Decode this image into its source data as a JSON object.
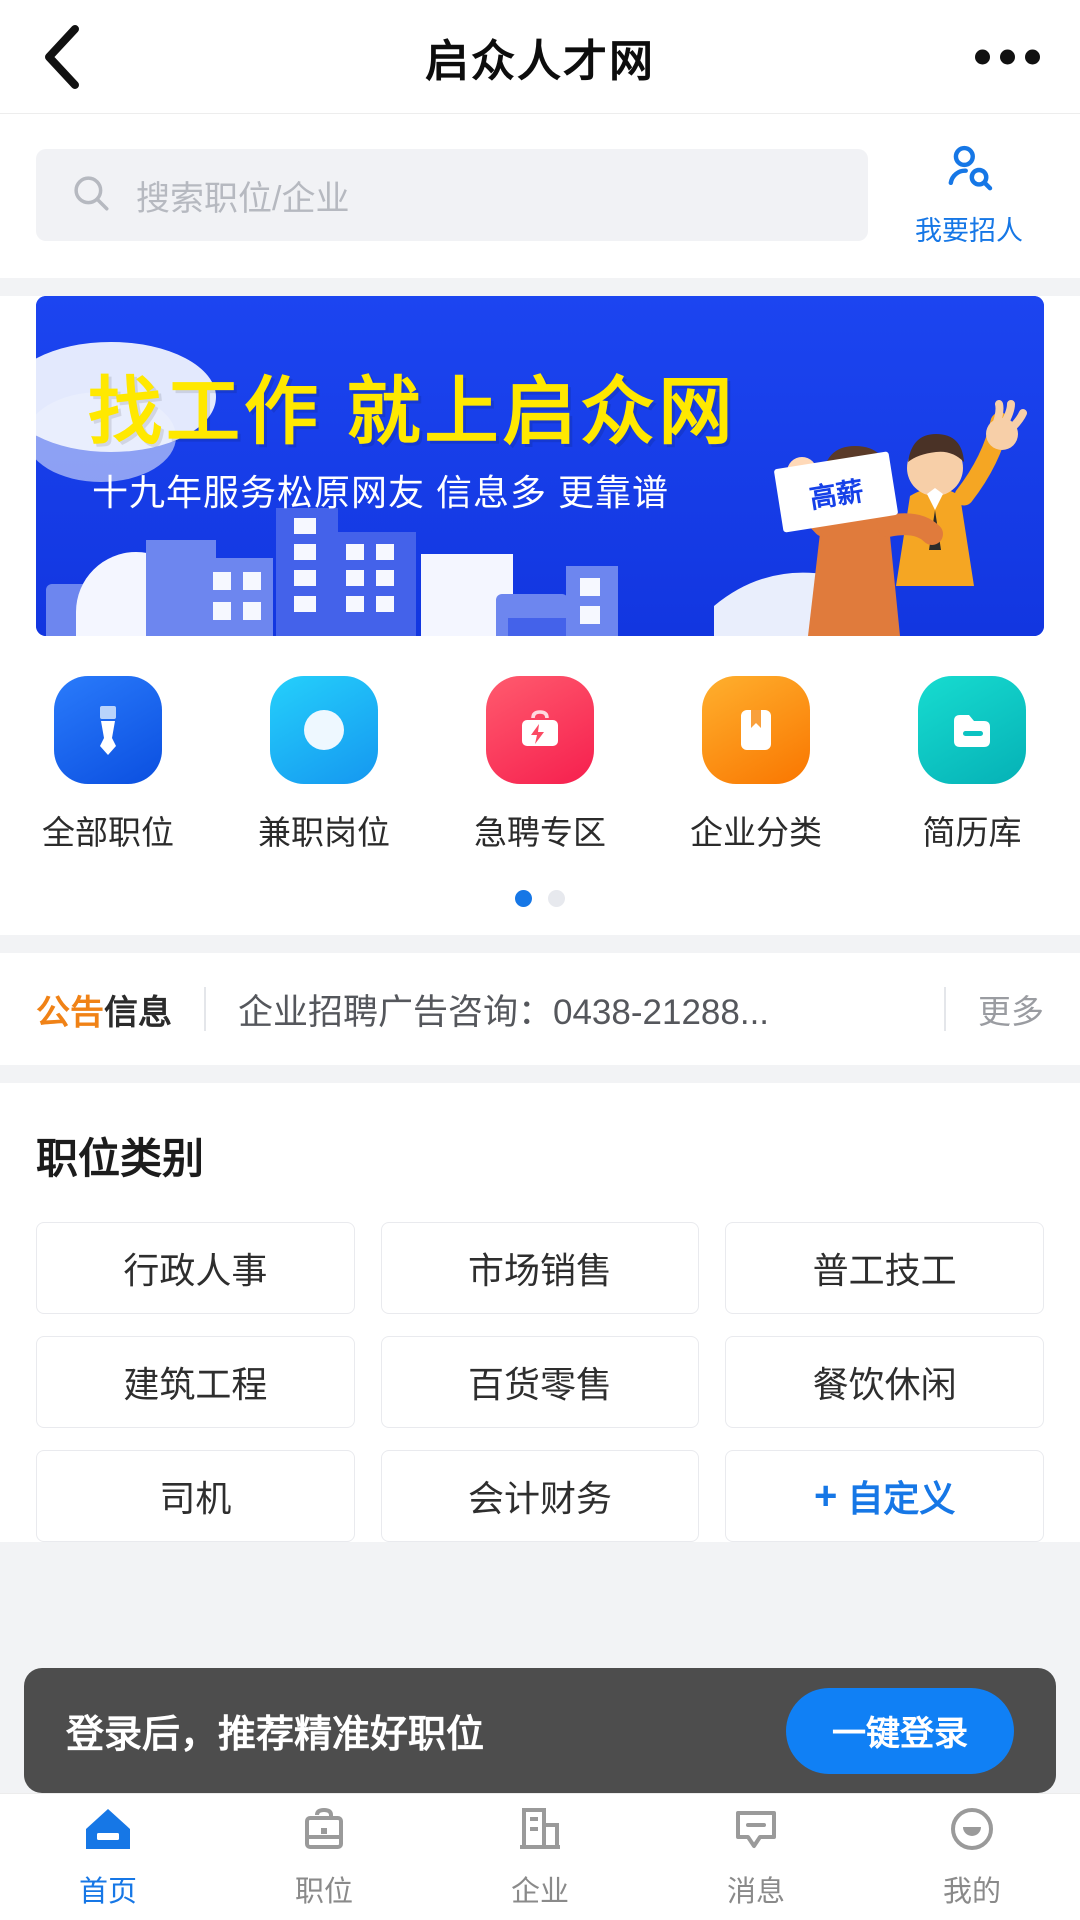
{
  "header": {
    "title": "启众人才网",
    "back_icon": "chevron-left-icon",
    "more_icon": "more-horizontal-icon"
  },
  "search": {
    "icon": "search-icon",
    "placeholder": "搜索职位/企业",
    "value": "",
    "recruit": {
      "icon": "person-search-icon",
      "label": "我要招人",
      "color": "#1677e6"
    }
  },
  "banner": {
    "title": "找工作 就上启众网",
    "subtitle": "十九年服务松原网友 信息多 更靠谱",
    "sign_text": "高薪",
    "bg_color": "#1540e8",
    "title_color": "#ffe800"
  },
  "quick_entries": [
    {
      "label": "全部职位",
      "icon": "tie-icon",
      "color": "#1464f0"
    },
    {
      "label": "兼职岗位",
      "icon": "compass-icon",
      "color": "#1bb8f5"
    },
    {
      "label": "急聘专区",
      "icon": "briefcase-bolt-icon",
      "color": "#f83a58"
    },
    {
      "label": "企业分类",
      "icon": "bookmark-book-icon",
      "color": "#fb8a00"
    },
    {
      "label": "简历库",
      "icon": "folder-icon",
      "color": "#0fc2c0"
    }
  ],
  "pagination": {
    "total": 2,
    "active_index": 0,
    "active_color": "#1677e6"
  },
  "notice": {
    "tag_highlight": "公告",
    "tag_rest": "信息",
    "tag_color": "#f08216",
    "text": "企业招聘广告咨询：0438-21288...",
    "more_label": "更多"
  },
  "categories": {
    "title": "职位类别",
    "items": [
      {
        "label": "行政人事",
        "custom": false
      },
      {
        "label": "市场销售",
        "custom": false
      },
      {
        "label": "普工技工",
        "custom": false
      },
      {
        "label": "建筑工程",
        "custom": false
      },
      {
        "label": "百货零售",
        "custom": false
      },
      {
        "label": "餐饮休闲",
        "custom": false
      },
      {
        "label": "司机",
        "custom": false
      },
      {
        "label": "会计财务",
        "custom": false
      },
      {
        "label": "自定义",
        "custom": true,
        "plus": "+"
      }
    ]
  },
  "login_bar": {
    "message": "登录后，推荐精准好职位",
    "button_label": "一键登录",
    "button_color": "#1080f5"
  },
  "tabbar": {
    "items": [
      {
        "label": "首页",
        "icon": "home-icon",
        "active": true
      },
      {
        "label": "职位",
        "icon": "briefcase-icon",
        "active": false
      },
      {
        "label": "企业",
        "icon": "building-icon",
        "active": false
      },
      {
        "label": "消息",
        "icon": "message-icon",
        "active": false
      },
      {
        "label": "我的",
        "icon": "user-circle-icon",
        "active": false
      }
    ],
    "active_color": "#1677e6",
    "inactive_color": "#8a8a8a"
  }
}
